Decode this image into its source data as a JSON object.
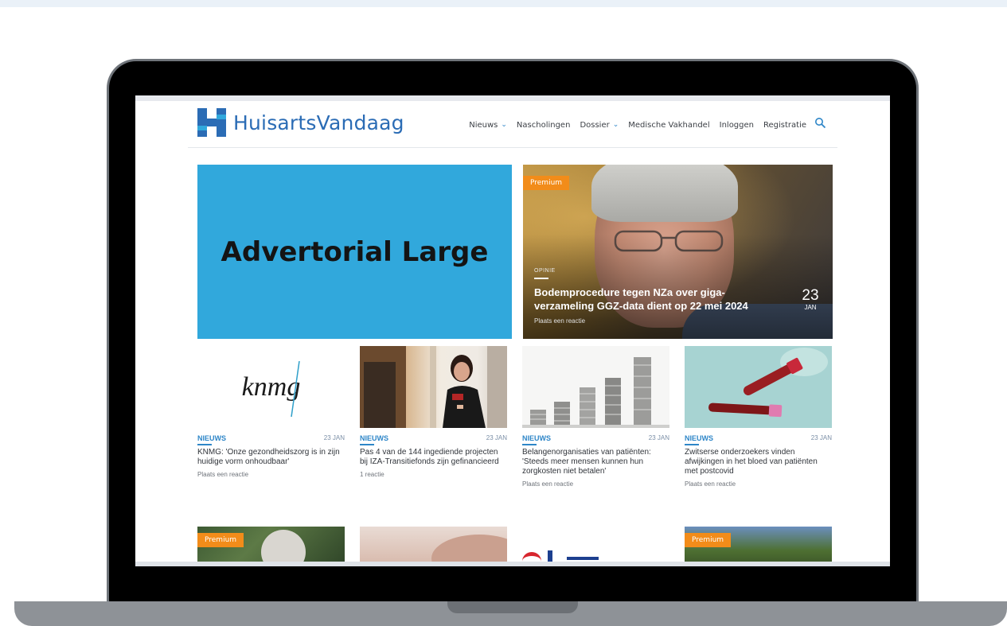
{
  "site": {
    "name": "HuisartsVandaag",
    "brand_color": "#2b6cb5"
  },
  "nav": {
    "items": [
      {
        "label": "Nieuws",
        "dropdown": true
      },
      {
        "label": "Nascholingen",
        "dropdown": false
      },
      {
        "label": "Dossier",
        "dropdown": true
      },
      {
        "label": "Medische Vakhandel",
        "dropdown": false
      },
      {
        "label": "Inloggen",
        "dropdown": false
      },
      {
        "label": "Registratie",
        "dropdown": false
      }
    ],
    "search_icon": "search-icon"
  },
  "advertorial": {
    "label": "Advertorial Large",
    "color": "#31a8dc"
  },
  "featured": {
    "badge": "Premium",
    "category": "OPINIE",
    "title": "Bodemprocedure tegen NZa over giga-verzameling GGZ-data dient op 22 mei 2024",
    "comments": "Plaats een reactie",
    "day": "23",
    "month": "JAN"
  },
  "cards": [
    {
      "category": "NIEUWS",
      "date": "23 JAN",
      "title": "KNMG: 'Onze gezondheidszorg is in zijn huidige vorm onhoudbaar'",
      "comments": "Plaats een reactie",
      "image_text": "knmg"
    },
    {
      "category": "NIEUWS",
      "date": "23 JAN",
      "title": "Pas 4 van de 144 ingediende projecten bij IZA-Transitiefonds zijn gefinancieerd",
      "comments": "1 reactie"
    },
    {
      "category": "NIEUWS",
      "date": "23 JAN",
      "title": "Belangenorganisaties van patiënten: 'Steeds meer mensen kunnen hun zorgkosten niet betalen'",
      "comments": "Plaats een reactie"
    },
    {
      "category": "NIEUWS",
      "date": "23 JAN",
      "title": "Zwitserse onderzoekers vinden afwijkingen in het bloed van patiënten met postcovid",
      "comments": "Plaats een reactie"
    }
  ],
  "bottom_row": {
    "badge_1": "Premium",
    "badge_4": "Premium"
  },
  "colors": {
    "accent": "#2e86c8",
    "premium": "#f28c1a"
  }
}
